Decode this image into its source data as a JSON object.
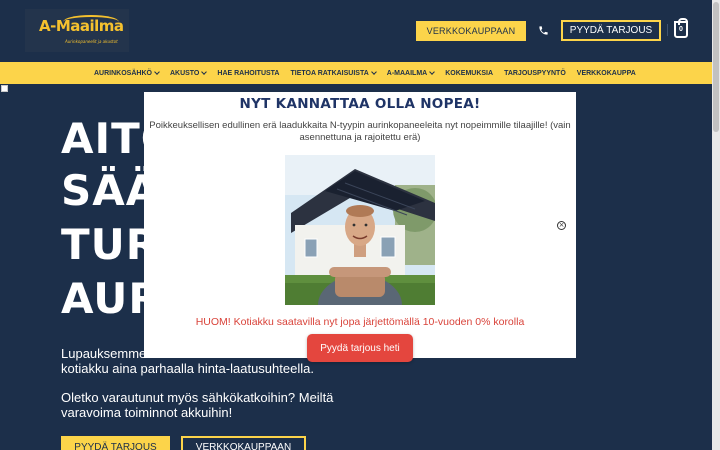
{
  "header": {
    "logo_title": "A-Maailma",
    "logo_tagline": "Aurinkopaneelit ja akustot",
    "shop_button": "VERKKOKAUPPAAN",
    "quote_button": "PYYDÄ TARJOUS",
    "cart_count": "0"
  },
  "nav": {
    "items": [
      {
        "label": "AURINKOSÄHKÖ",
        "dropdown": true
      },
      {
        "label": "AKUSTO",
        "dropdown": true
      },
      {
        "label": "HAE RAHOITUSTA",
        "dropdown": false
      },
      {
        "label": "TIETOA RATKAISUISTA",
        "dropdown": true
      },
      {
        "label": "A-MAAILMA",
        "dropdown": true
      },
      {
        "label": "KOKEMUKSIA",
        "dropdown": false
      },
      {
        "label": "TARJOUSPYYNTÖ",
        "dropdown": false
      },
      {
        "label": "VERKKOKAUPPA",
        "dropdown": false
      }
    ]
  },
  "hero": {
    "lines": [
      "AITO",
      "SÄÄ",
      "TUR",
      "AUR"
    ],
    "paragraph1": "Lupauksemme ... kotiakku aina parhaalla hinta-laatusuhteella.",
    "paragraph1_line1": "Lupauksemme",
    "paragraph1_line2": "kotiakku aina parhaalla hinta-laatusuhteella.",
    "paragraph2_line1": "Oletko varautunut myös sähkökatkoihin? Meiltä",
    "paragraph2_line2": "varavoima toiminnot akkuihin!",
    "quote_button": "PYYDÄ TARJOUS",
    "shop_button": "VERKKOKAUPPAAN"
  },
  "popup": {
    "title": "NYT KANNATTAA OLLA NOPEA!",
    "body": "Poikkeuksellisen edullinen erä laadukkaita N-tyypin aurinkopaneeleita nyt nopeimmille tilaajille! (vain asennettuna ja rajoitettu erä)",
    "promo": "HUOM! Kotiakku saatavilla nyt jopa järjettömällä 10-vuoden 0% korolla",
    "cta": "Pyydä tarjous heti",
    "close_symbol": "×"
  },
  "colors": {
    "navy": "#1c2f4a",
    "yellow": "#fcd44a",
    "red": "#e4463e",
    "popup_title": "#1f3466"
  }
}
